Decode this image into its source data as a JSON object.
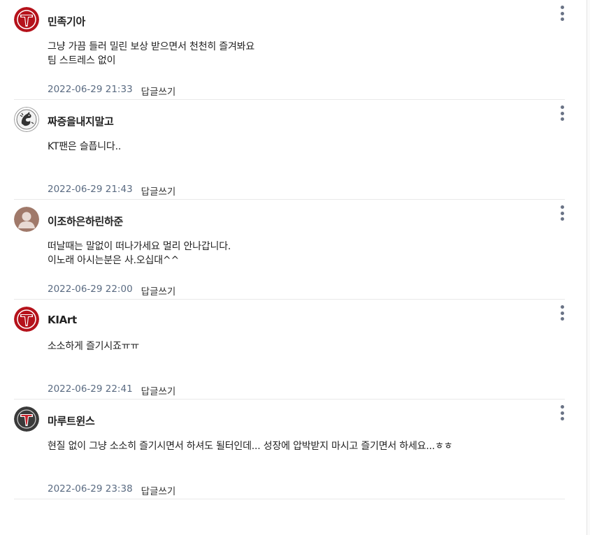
{
  "comments": [
    {
      "avatar": "kia-tigers-logo",
      "nickname": "민족기아",
      "text": "그냥 가끔 들러 밀린 보상 받으면서 천천히 즐겨봐요\n팀 스트레스 없이",
      "date": "2022-06-29 21:33",
      "reply_label": "답글쓰기"
    },
    {
      "avatar": "dragon-emblem",
      "nickname": "짜증을내지말고",
      "text": "KT팬은 슬픕니다..",
      "date": "2022-06-29 21:43",
      "reply_label": "답글쓰기"
    },
    {
      "avatar": "default-user",
      "nickname": "이조하은하린하준",
      "text": "떠날때는 말없이 떠나가세요 멀리 안나갑니다.\n이노래 아시는분은 사.오십대^^",
      "date": "2022-06-29 22:00",
      "reply_label": "답글쓰기"
    },
    {
      "avatar": "kia-tigers-logo",
      "nickname": "KIArt",
      "text": "소소하게 즐기시죠ㅠㅠ",
      "date": "2022-06-29 22:41",
      "reply_label": "답글쓰기"
    },
    {
      "avatar": "kia-tigers-logo-dark",
      "nickname": "마루트윈스",
      "text": "현질 없이 그냥 소소히 즐기시면서 하셔도 될터인데... 성장에 압박받지 마시고 즐기면서 하세요...ㅎㅎ",
      "date": "2022-06-29 23:38",
      "reply_label": "답글쓰기"
    }
  ],
  "colors": {
    "date": "#5a6b82",
    "kia_red": "#b5121b",
    "divider": "#e9e9e9",
    "more_dots": "#6a7386"
  }
}
